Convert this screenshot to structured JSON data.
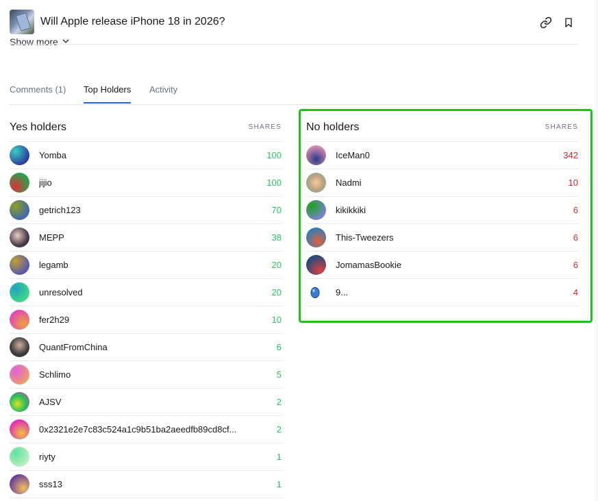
{
  "header": {
    "title": "Will Apple release iPhone 18 in 2026?",
    "show_more": "Show more"
  },
  "tabs": [
    {
      "label": "Comments (1)",
      "active": false
    },
    {
      "label": "Top Holders",
      "active": true
    },
    {
      "label": "Activity",
      "active": false
    }
  ],
  "shares_label": "SHARES",
  "yes_holders": {
    "title": "Yes holders",
    "color": "#22c55e",
    "rows": [
      {
        "name": "Yomba",
        "shares": "100"
      },
      {
        "name": "jijio",
        "shares": "100"
      },
      {
        "name": "getrich123",
        "shares": "70"
      },
      {
        "name": "MEPP",
        "shares": "38"
      },
      {
        "name": "legamb",
        "shares": "20"
      },
      {
        "name": "unresolved",
        "shares": "20"
      },
      {
        "name": "fer2h29",
        "shares": "10"
      },
      {
        "name": "QuantFromChina",
        "shares": "6"
      },
      {
        "name": "Schlimo",
        "shares": "5"
      },
      {
        "name": "AJSV",
        "shares": "2"
      },
      {
        "name": "0x2321e2e7c83c524a1c9b51ba2aeedfb89cd8cf...",
        "shares": "2"
      },
      {
        "name": "riyty",
        "shares": "1"
      },
      {
        "name": "sss13",
        "shares": "1"
      }
    ]
  },
  "no_holders": {
    "title": "No holders",
    "color": "#dc2626",
    "rows": [
      {
        "name": "IceMan0",
        "shares": "342"
      },
      {
        "name": "Nadmi",
        "shares": "10"
      },
      {
        "name": "kikikkiki",
        "shares": "6"
      },
      {
        "name": "This-Tweezers",
        "shares": "6"
      },
      {
        "name": "JomamasBookie",
        "shares": "6"
      },
      {
        "name": "9...",
        "shares": "4"
      }
    ]
  },
  "highlight_color": "#22c01a"
}
